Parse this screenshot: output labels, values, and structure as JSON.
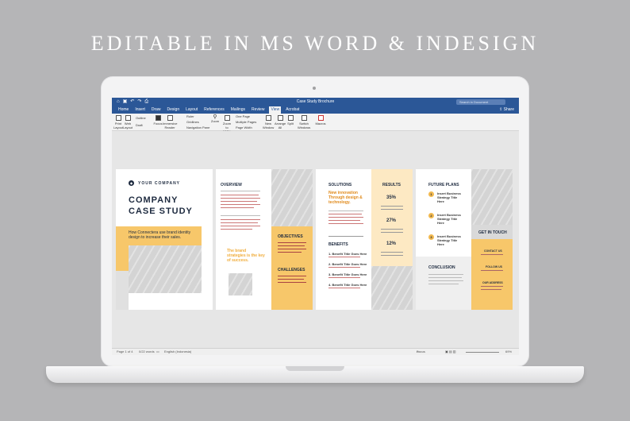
{
  "headline": "EDITABLE IN MS WORD & INDESIGN",
  "word": {
    "doc_title": "Case Study Brochure",
    "search_placeholder": "Search in Document",
    "share": "Share",
    "tabs": [
      "Home",
      "Insert",
      "Draw",
      "Design",
      "Layout",
      "References",
      "Mailings",
      "Review",
      "View",
      "Acrobat"
    ],
    "active_tab": "View",
    "ribbon": {
      "print_layout": "Print Layout",
      "web_layout": "Web Layout",
      "outline": "Outline",
      "draft": "Draft",
      "focus": "Focus",
      "immersive_reader": "Immersive Reader",
      "ruler": "Ruler",
      "gridlines": "Gridlines",
      "navigation_pane": "Navigation Pane",
      "zoom": "Zoom",
      "zoom_100": "Zoom to 100%",
      "one_page": "One Page",
      "multiple_pages": "Multiple Pages",
      "page_width": "Page Width",
      "new_window": "New Window",
      "arrange_all": "Arrange All",
      "split": "Split",
      "switch_windows": "Switch Windows",
      "macros": "Macros"
    },
    "status": {
      "page": "Page 1 of 4",
      "words": "0/22 words",
      "language": "English (Indonesia)",
      "focus": "Focus",
      "zoom": "69%"
    }
  },
  "pages": {
    "p1": {
      "company": "YOUR COMPANY",
      "title_line1": "COMPANY",
      "title_line2": "CASE STUDY",
      "tagline": "How Connectera use brand identity design to increase their sales."
    },
    "p2": {
      "overview": "OVERVIEW",
      "quote": "The brand strategies is the key of success.",
      "objectives": "OBJECTIVES",
      "challenges": "CHALLENGES"
    },
    "p3": {
      "solutions": "SOLUTIONS",
      "highlight": "New innovation Through design & technology.",
      "benefits": "BENEFITS",
      "benefit_items": [
        "1. Benefit Title Goes Here",
        "2. Benefit Title Goes Here",
        "3. Benefit Title Goes Here",
        "4. Benefit Title Goes Here"
      ],
      "results": "RESULTS",
      "percents": [
        "35%",
        "27%",
        "12%"
      ]
    },
    "p4": {
      "future_plans": "FUTURE PLANS",
      "plan_items": [
        "Insert Business Strategy Title Here",
        "Insert Business Strategy Title Here",
        "Insert Business Strategy Title Here"
      ],
      "plan_numbers": [
        "1",
        "2",
        "3"
      ],
      "conclusion": "CONCLUSION",
      "get_in_touch": "GET IN TOUCH",
      "contact_us": "CONTACT US",
      "follow_us": "FOLLOW US",
      "our_address": "OUR ADDRESS"
    }
  },
  "colors": {
    "title_bar": "#2b5797",
    "accent_yellow": "#f7c76a",
    "accent_orange": "#e08a1b",
    "navy": "#1d2a3f"
  }
}
